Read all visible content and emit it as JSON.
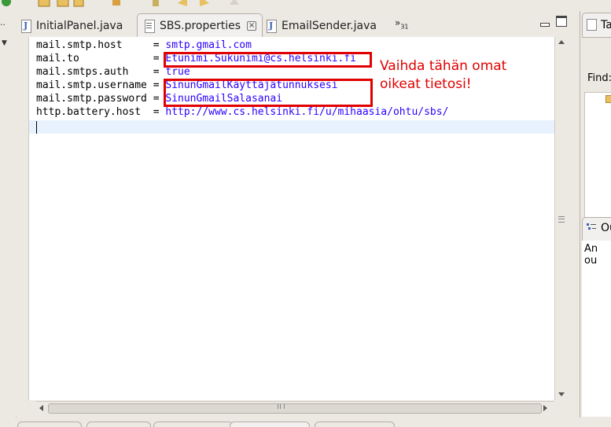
{
  "editor": {
    "tabs": [
      {
        "label": "InitialPanel.java",
        "icon": "java-file-icon",
        "active": false
      },
      {
        "label": "SBS.properties",
        "icon": "properties-file-icon",
        "active": true,
        "closable": true
      },
      {
        "label": "EmailSender.java",
        "icon": "java-file-icon",
        "active": false
      }
    ],
    "overflow_label": "»",
    "overflow_count": "31",
    "lines": [
      {
        "key": "mail.smtp.host     = ",
        "value": "smtp.gmail.com"
      },
      {
        "key": "mail.to            = ",
        "value": "Etunimi.Sukunimi@cs.helsinki.fi"
      },
      {
        "key": "mail.smtps.auth    = ",
        "value": "true"
      },
      {
        "key": "mail.smtp.username = ",
        "value": "SinunGmailKäyttäjätunnuksesi"
      },
      {
        "key": "mail.smtp.password = ",
        "value": "SinunGmailSalasanai"
      },
      {
        "key": "http.battery.host  = ",
        "value": "http://www.cs.helsinki.fi/u/mihaasia/ohtu/sbs/"
      }
    ]
  },
  "annotation": {
    "line1": "Vaihda tähän omat",
    "line2": "oikeat tietosi!",
    "color": "#e00000"
  },
  "right_panel": {
    "task_tab_label": "Ta",
    "find_label": "Find:",
    "outline_tab_label": "Ou",
    "outline_body": "An ou"
  },
  "colors": {
    "value_text": "#2a00ff",
    "current_line": "#e8f2fe",
    "chrome": "#ece8e2"
  }
}
